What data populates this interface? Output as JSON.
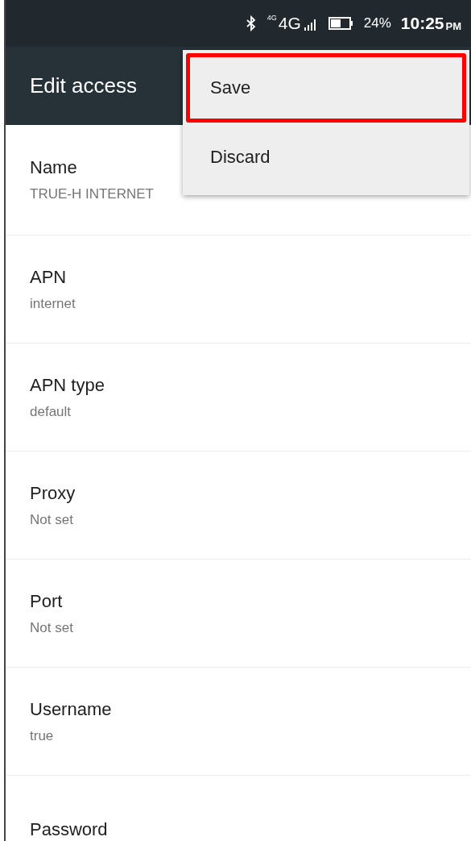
{
  "status_bar": {
    "network_small": "4G",
    "network": "4G",
    "battery": "24%",
    "time": "10:25",
    "time_suffix": "PM"
  },
  "toolbar": {
    "title": "Edit access"
  },
  "menu": [
    {
      "label": "Save",
      "highlighted": true
    },
    {
      "label": "Discard",
      "highlighted": false
    }
  ],
  "settings": [
    {
      "label": "Name",
      "value": "TRUE-H INTERNET"
    },
    {
      "label": "APN",
      "value": "internet"
    },
    {
      "label": "APN type",
      "value": "default"
    },
    {
      "label": "Proxy",
      "value": "Not set"
    },
    {
      "label": "Port",
      "value": "Not set"
    },
    {
      "label": "Username",
      "value": "true"
    },
    {
      "label": "Password"
    }
  ]
}
